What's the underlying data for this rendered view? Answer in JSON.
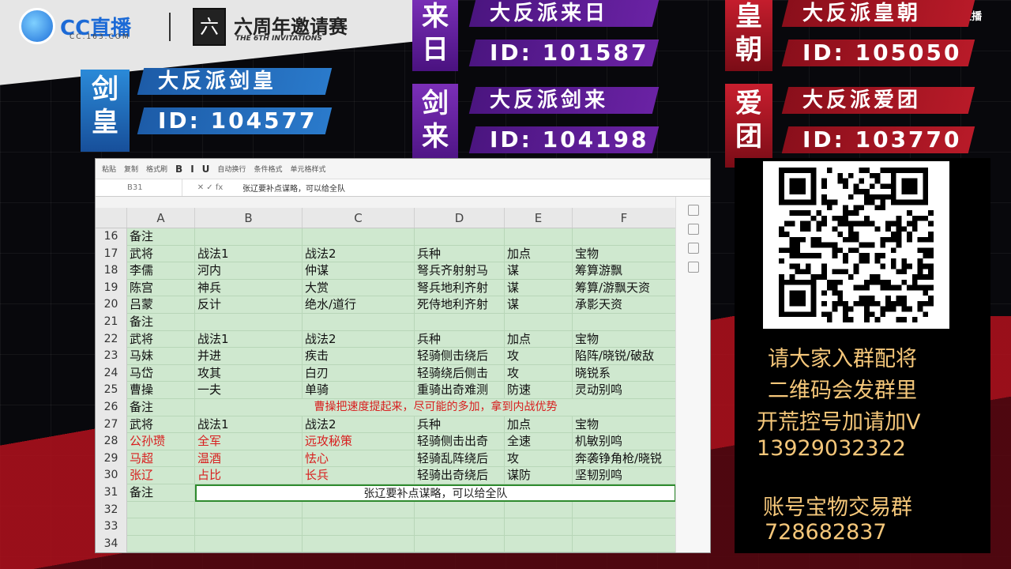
{
  "header": {
    "cc_logo_text": "CC直播",
    "cc_domain": "CC.163.COM",
    "event_title": "六周年邀请赛",
    "event_subtitle": "THE 6TH INVITATIONS",
    "corner_logo": "CC直播"
  },
  "teams": [
    {
      "badge": "剑\n皇",
      "name": "大反派剑皇",
      "id": "ID: 104577",
      "color": "blue"
    },
    {
      "badge": "来\n日",
      "name": "大反派来日",
      "id": "ID: 101587",
      "color": "purple"
    },
    {
      "badge": "剑\n来",
      "name": "大反派剑来",
      "id": "ID: 104198",
      "color": "purple"
    },
    {
      "badge": "皇\n朝",
      "name": "大反派皇朝",
      "id": "ID: 105050",
      "color": "red"
    },
    {
      "badge": "爱\n团",
      "name": "大反派爱团",
      "id": "ID: 103770",
      "color": "red"
    }
  ],
  "spreadsheet": {
    "toolbar": [
      "粘贴",
      "复制",
      "格式刷",
      "B",
      "I",
      "U",
      "自动换行",
      "条件格式",
      "单元格样式"
    ],
    "name_box": "B31",
    "formula_text": "张辽要补点谋略，可以给全队",
    "columns": [
      "A",
      "B",
      "C",
      "D",
      "E",
      "F"
    ],
    "rows": [
      {
        "n": "16",
        "cells": [
          "备注",
          "",
          "",
          "",
          "",
          ""
        ]
      },
      {
        "n": "17",
        "cells": [
          "武将",
          "战法1",
          "战法2",
          "兵种",
          "加点",
          "宝物"
        ]
      },
      {
        "n": "18",
        "cells": [
          "李儒",
          "河内",
          "仲谋",
          "弩兵齐射射马",
          "谋",
          "筹算游飘"
        ]
      },
      {
        "n": "19",
        "cells": [
          "陈宫",
          "神兵",
          "大赏",
          "弩兵地利齐射",
          "谋",
          "筹算/游飘天资"
        ]
      },
      {
        "n": "20",
        "cells": [
          "吕蒙",
          "反计",
          "绝水/道行",
          "死侍地利齐射",
          "谋",
          "承影天资"
        ]
      },
      {
        "n": "21",
        "cells": [
          "备注",
          "",
          "",
          "",
          "",
          ""
        ]
      },
      {
        "n": "22",
        "cells": [
          "武将",
          "战法1",
          "战法2",
          "兵种",
          "加点",
          "宝物"
        ]
      },
      {
        "n": "23",
        "cells": [
          "马妹",
          "并进",
          "疾击",
          "轻骑侧击绕后",
          "攻",
          "陷阵/晓锐/破敌"
        ]
      },
      {
        "n": "24",
        "cells": [
          "马岱",
          "攻其",
          "白刃",
          "轻骑绕后侧击",
          "攻",
          "晓锐系"
        ]
      },
      {
        "n": "25",
        "cells": [
          "曹操",
          "一夫",
          "单骑",
          "重骑出奇难测",
          "防速",
          "灵动别鸣"
        ]
      },
      {
        "n": "26",
        "cells": [
          "备注"
        ],
        "note": "曹操把速度提起来，尽可能的多加，拿到内战优势"
      },
      {
        "n": "27",
        "cells": [
          "武将",
          "战法1",
          "战法2",
          "兵种",
          "加点",
          "宝物"
        ]
      },
      {
        "n": "28",
        "cells": [
          "公孙瓒",
          "全军",
          "远攻秘策",
          "轻骑侧击出奇",
          "全速",
          "机敏别鸣"
        ],
        "red": true
      },
      {
        "n": "29",
        "cells": [
          "马超",
          "温酒",
          "怯心",
          "轻骑乱阵绕后",
          "攻",
          "奔袭铮角枪/晓锐"
        ],
        "red": true
      },
      {
        "n": "30",
        "cells": [
          "张辽",
          "占比",
          "长兵",
          "轻骑出奇绕后",
          "谋防",
          "坚韧别鸣"
        ],
        "red": true
      },
      {
        "n": "31",
        "cells": [
          "备注"
        ],
        "note": "张辽要补点谋略，可以给全队",
        "selected": true
      },
      {
        "n": "32",
        "cells": [
          "",
          "",
          "",
          "",
          "",
          ""
        ]
      },
      {
        "n": "33",
        "cells": [
          "",
          "",
          "",
          "",
          "",
          ""
        ]
      },
      {
        "n": "34",
        "cells": [
          "",
          "",
          "",
          "",
          "",
          ""
        ]
      }
    ]
  },
  "promo": {
    "line1": "请大家入群配将",
    "line2": "二维码会发群里",
    "line3": "开荒控号加请加V",
    "line4": "13929032322",
    "line5": "账号宝物交易群",
    "line6": "728682837"
  }
}
